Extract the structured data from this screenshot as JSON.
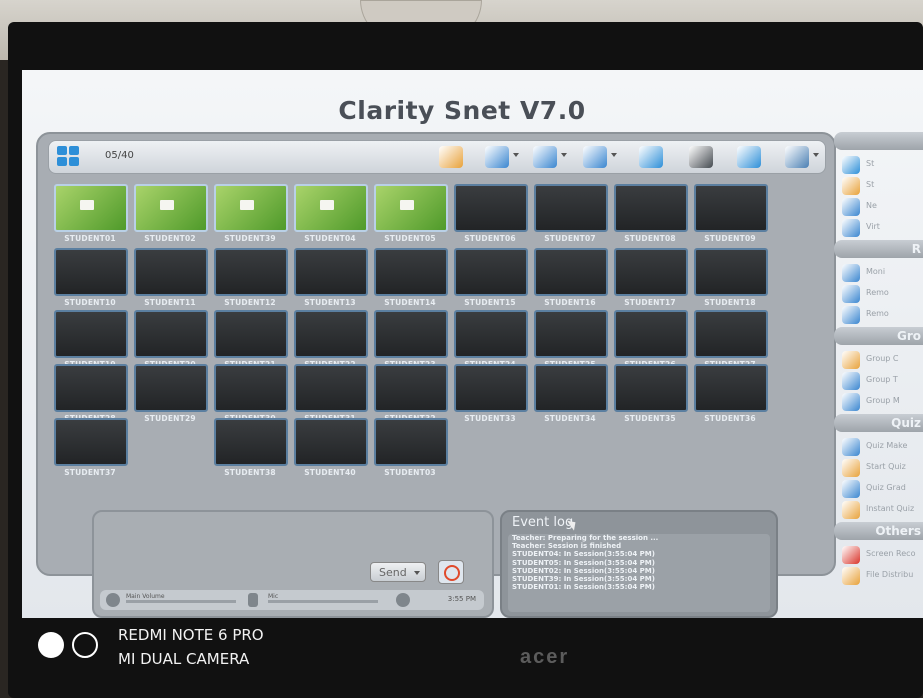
{
  "app": {
    "title": "Clarity Snet V7.0"
  },
  "toolbar": {
    "count": "05/40",
    "icons": [
      {
        "name": "blank-screen-icon",
        "color": "#e8a23a"
      },
      {
        "name": "lock-icon",
        "color": "#3a86d0"
      },
      {
        "name": "file-send-icon",
        "color": "#3a86d0"
      },
      {
        "name": "web-block-icon",
        "color": "#3a86d0"
      },
      {
        "name": "attendance-icon",
        "color": "#2d8fd8"
      },
      {
        "name": "monitor-dark-icon",
        "color": "#444a50"
      },
      {
        "name": "monitor-blue-icon",
        "color": "#2d8fd8"
      },
      {
        "name": "layout-menu-icon",
        "color": "#4a7fb3"
      }
    ]
  },
  "students": {
    "rows": [
      [
        {
          "label": "STUDENT01",
          "state": "live"
        },
        {
          "label": "STUDENT02",
          "state": "live"
        },
        {
          "label": "STUDENT39",
          "state": "live"
        },
        {
          "label": "STUDENT04",
          "state": "live"
        },
        {
          "label": "STUDENT05",
          "state": "live"
        },
        {
          "label": "STUDENT06",
          "state": "off"
        },
        {
          "label": "STUDENT07",
          "state": "off"
        },
        {
          "label": "STUDENT08",
          "state": "off"
        },
        {
          "label": "STUDENT09",
          "state": "off"
        }
      ],
      [
        {
          "label": "STUDENT10",
          "state": "off"
        },
        {
          "label": "STUDENT11",
          "state": "off"
        },
        {
          "label": "STUDENT12",
          "state": "off"
        },
        {
          "label": "STUDENT13",
          "state": "off"
        },
        {
          "label": "STUDENT14",
          "state": "off"
        },
        {
          "label": "STUDENT15",
          "state": "off"
        },
        {
          "label": "STUDENT16",
          "state": "off"
        },
        {
          "label": "STUDENT17",
          "state": "off"
        },
        {
          "label": "STUDENT18",
          "state": "off"
        }
      ],
      [
        {
          "label": "STUDENT19",
          "state": "off"
        },
        {
          "label": "STUDENT20",
          "state": "off"
        },
        {
          "label": "STUDENT21",
          "state": "off"
        },
        {
          "label": "STUDENT22",
          "state": "off"
        },
        {
          "label": "STUDENT23",
          "state": "off"
        },
        {
          "label": "STUDENT24",
          "state": "off"
        },
        {
          "label": "STUDENT25",
          "state": "off"
        },
        {
          "label": "STUDENT26",
          "state": "off"
        },
        {
          "label": "STUDENT27",
          "state": "off"
        }
      ],
      [
        {
          "label": "STUDENT28",
          "state": "off"
        },
        {
          "label": "STUDENT29",
          "state": "off"
        },
        {
          "label": "STUDENT30",
          "state": "off"
        },
        {
          "label": "STUDENT31",
          "state": "off"
        },
        {
          "label": "STUDENT32",
          "state": "off"
        },
        {
          "label": "STUDENT33",
          "state": "off"
        },
        {
          "label": "STUDENT34",
          "state": "off"
        },
        {
          "label": "STUDENT35",
          "state": "off"
        },
        {
          "label": "STUDENT36",
          "state": "off"
        }
      ],
      [
        {
          "label": "STUDENT37",
          "state": "off"
        },
        {
          "label": "STUDENT38",
          "state": "off"
        },
        {
          "label": "STUDENT40",
          "state": "off"
        },
        {
          "label": "STUDENT03",
          "state": "off"
        }
      ]
    ]
  },
  "message": {
    "send_label": "Send",
    "main_volume_label": "Main Volume",
    "mic_label": "Mic",
    "time": "3:55 PM"
  },
  "event_log": {
    "title": "Event log",
    "lines": [
      "Teacher: Preparing for the session ...",
      "Teacher: Session is finished",
      "STUDENT04: In Session(3:55:04 PM)",
      "STUDENT05: In Session(3:55:04 PM)",
      "STUDENT02: In Session(3:55:04 PM)",
      "STUDENT39: In Session(3:55:04 PM)",
      "STUDENT01: In Session(3:55:04 PM)"
    ]
  },
  "sidebar": {
    "sections": [
      {
        "header": "",
        "items": [
          {
            "label": "St",
            "icon": "students-icon",
            "color": "#2d8fd8"
          },
          {
            "label": "St",
            "icon": "user-icon",
            "color": "#e8a23a"
          },
          {
            "label": "Ne",
            "icon": "network-icon",
            "color": "#3a86d0"
          },
          {
            "label": "Virt",
            "icon": "virtual-icon",
            "color": "#3a86d0"
          }
        ]
      },
      {
        "header": "R",
        "items": [
          {
            "label": "Moni",
            "icon": "monitor-icon",
            "color": "#3a86d0"
          },
          {
            "label": "Remo",
            "icon": "remote-icon",
            "color": "#3a86d0"
          },
          {
            "label": "Remo",
            "icon": "remote2-icon",
            "color": "#3a86d0"
          }
        ]
      },
      {
        "header": "Gro",
        "items": [
          {
            "label": "Group C",
            "icon": "group-chat-icon",
            "color": "#e8a23a"
          },
          {
            "label": "Group T",
            "icon": "group-teach-icon",
            "color": "#3a86d0"
          },
          {
            "label": "Group M",
            "icon": "group-manage-icon",
            "color": "#3a86d0"
          }
        ]
      },
      {
        "header": "Quiz",
        "items": [
          {
            "label": "Quiz Make",
            "icon": "quiz-make-icon",
            "color": "#3a86d0"
          },
          {
            "label": "Start Quiz",
            "icon": "quiz-start-icon",
            "color": "#e8a23a"
          },
          {
            "label": "Quiz Grad",
            "icon": "quiz-grade-icon",
            "color": "#3a86d0"
          },
          {
            "label": "Instant Quiz",
            "icon": "quiz-instant-icon",
            "color": "#e8a23a"
          }
        ]
      },
      {
        "header": "Others",
        "items": [
          {
            "label": "Screen Reco",
            "icon": "record-icon",
            "color": "#d9342a"
          },
          {
            "label": "File Distribu",
            "icon": "file-dist-icon",
            "color": "#e8a23a"
          }
        ]
      }
    ]
  },
  "photo": {
    "camera_line1": "REDMI NOTE 6 PRO",
    "camera_line2": "MI DUAL CAMERA",
    "monitor_brand": "acer"
  }
}
